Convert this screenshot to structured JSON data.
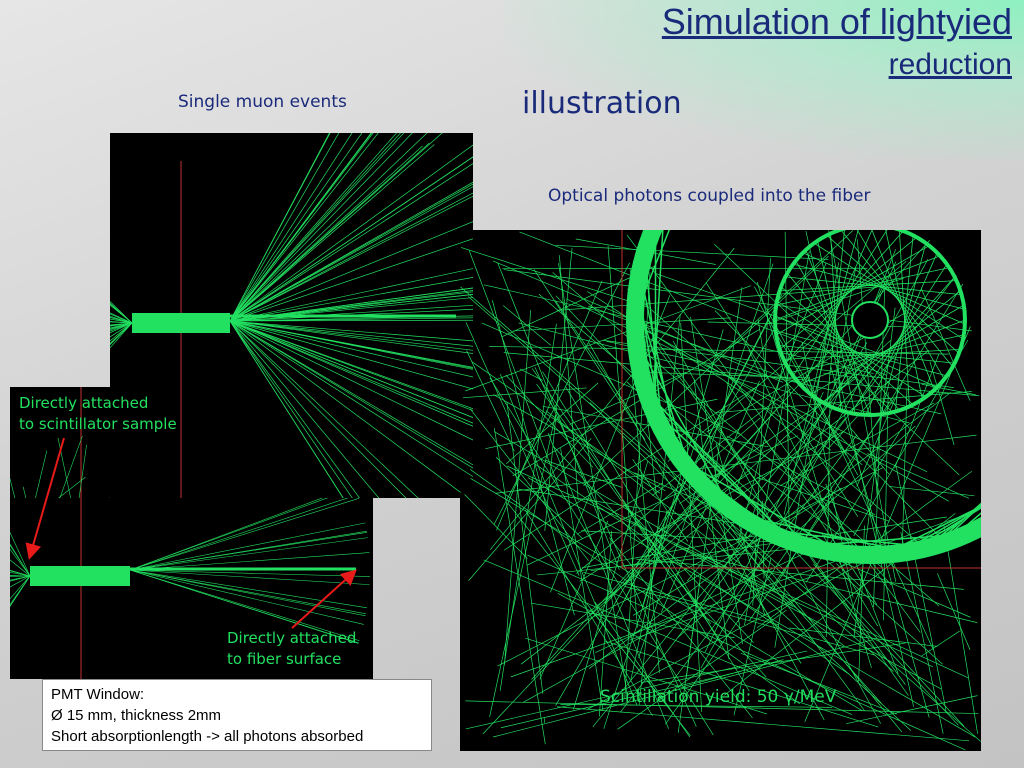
{
  "slide": {
    "title_line1": "Simulation of lightyied",
    "title_line2": " reduction",
    "subtitle": "illustration",
    "single_muon_label": "Single muon events",
    "optical_label": "Optical photons coupled into the fiber",
    "annotation_scintillator": [
      "Directly attached",
      "to scintillator sample"
    ],
    "annotation_fiber": [
      "Directly attached",
      "to fiber surface"
    ],
    "pmt_box": [
      "PMT Window:",
      "Ø 15 mm, thickness 2mm",
      "Short absorptionlength -> all photons absorbed"
    ],
    "yield_label": "Scintillation yield: 50 γ/MeV"
  },
  "colors": {
    "title": "#1a2a7a",
    "photon_track": "#22e060",
    "annotation_arrow": "#e81a1a",
    "panel_bg": "#000000"
  }
}
